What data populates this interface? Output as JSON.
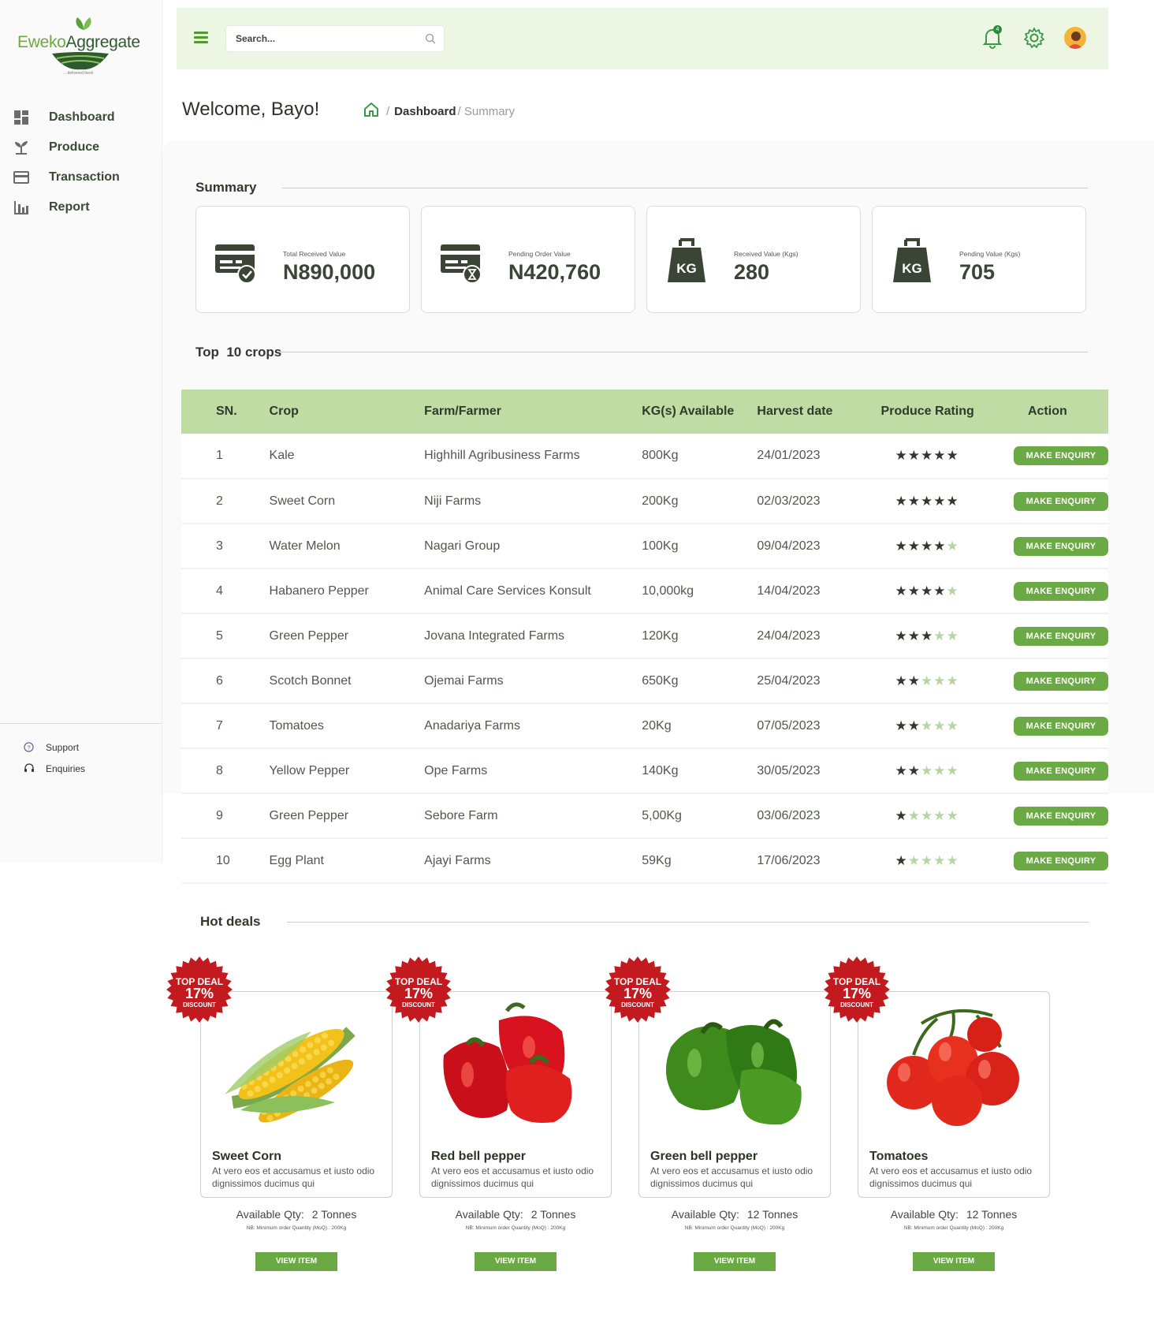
{
  "brand": {
    "name_part1": "Eweko",
    "name_part2": "Aggregate",
    "tagline": "... delivered fresh",
    "primary_color": "#6aa944",
    "topbar_color": "#edf5e3",
    "table_header_color": "#c0dca5"
  },
  "sidebar": {
    "items": [
      {
        "label": "Dashboard",
        "icon": "dashboard-grid-icon"
      },
      {
        "label": "Produce",
        "icon": "sprout-icon"
      },
      {
        "label": "Transaction",
        "icon": "card-icon"
      },
      {
        "label": "Report",
        "icon": "bar-chart-icon"
      }
    ],
    "bottom_items": [
      {
        "label": "Support",
        "icon": "help-circle-icon"
      },
      {
        "label": "Enquiries",
        "icon": "headset-icon"
      }
    ]
  },
  "topbar": {
    "search_placeholder": "Search...",
    "notification_count": "4"
  },
  "header": {
    "welcome": "Welcome, Bayo!",
    "breadcrumb_current": "Dashboard",
    "breadcrumb_sub": "/ Summary"
  },
  "summary": {
    "title": "Summary",
    "cards": [
      {
        "label": "Total Received Value",
        "value": "N890,000",
        "icon": "card-check-icon"
      },
      {
        "label": "Pending Order Value",
        "value": "N420,760",
        "icon": "card-hourglass-icon"
      },
      {
        "label": "Received Value (Kgs)",
        "value": "280",
        "icon": "kg-weight-icon"
      },
      {
        "label": "Pending Value (Kgs)",
        "value": "705",
        "icon": "kg-weight-icon"
      }
    ]
  },
  "crops": {
    "title": "Top  10 crops",
    "columns": [
      "SN.",
      "Crop",
      "Farm/Farmer",
      "KG(s) Available",
      "Harvest date",
      "Produce Rating",
      "Action"
    ],
    "action_label": "MAKE ENQUIRY",
    "rows": [
      {
        "sn": "1",
        "crop": "Kale",
        "farm": "Highhill Agribusiness Farms",
        "kg": "800Kg",
        "date": "24/01/2023",
        "rating": 5
      },
      {
        "sn": "2",
        "crop": "Sweet Corn",
        "farm": "Niji Farms",
        "kg": "200Kg",
        "date": "02/03/2023",
        "rating": 5
      },
      {
        "sn": "3",
        "crop": "Water Melon",
        "farm": "Nagari Group",
        "kg": "100Kg",
        "date": "09/04/2023",
        "rating": 4
      },
      {
        "sn": "4",
        "crop": "Habanero Pepper",
        "farm": "Animal Care Services Konsult",
        "kg": "10,000kg",
        "date": "14/04/2023",
        "rating": 4
      },
      {
        "sn": "5",
        "crop": "Green Pepper",
        "farm": "Jovana Integrated Farms",
        "kg": "120Kg",
        "date": "24/04/2023",
        "rating": 3
      },
      {
        "sn": "6",
        "crop": "Scotch Bonnet",
        "farm": "Ojemai Farms",
        "kg": "650Kg",
        "date": "25/04/2023",
        "rating": 2
      },
      {
        "sn": "7",
        "crop": "Tomatoes",
        "farm": "Anadariya Farms",
        "kg": "20Kg",
        "date": "07/05/2023",
        "rating": 2
      },
      {
        "sn": "8",
        "crop": "Yellow Pepper",
        "farm": "Ope Farms",
        "kg": "140Kg",
        "date": "30/05/2023",
        "rating": 2
      },
      {
        "sn": "9",
        "crop": "Green Pepper",
        "farm": "Sebore Farm",
        "kg": "5,00Kg",
        "date": "03/06/2023",
        "rating": 1
      },
      {
        "sn": "10",
        "crop": "Egg Plant",
        "farm": "Ajayi Farms",
        "kg": "59Kg",
        "date": "17/06/2023",
        "rating": 1
      }
    ]
  },
  "deals": {
    "title": "Hot deals",
    "badge_top": "TOP DEAL",
    "badge_pct": "17%",
    "badge_bottom": "DISCOUNT",
    "qty_label": "Available Qty:",
    "moq_note": "NB: Minimum order Quantity (MoQ) : 200Kg",
    "button_label": "VIEW ITEM",
    "items": [
      {
        "name": "Sweet Corn",
        "desc": "At vero eos et accusamus et iusto odio dignissimos ducimus qui",
        "qty": "2 Tonnes",
        "image": "corn-image"
      },
      {
        "name": "Red bell pepper",
        "desc": "At vero eos et accusamus et iusto odio dignissimos ducimus qui",
        "qty": "2 Tonnes",
        "image": "red-pepper-image"
      },
      {
        "name": "Green bell pepper",
        "desc": "At vero eos et accusamus et iusto odio dignissimos ducimus qui",
        "qty": "12 Tonnes",
        "image": "green-pepper-image"
      },
      {
        "name": "Tomatoes",
        "desc": "At vero eos et accusamus et iusto odio dignissimos ducimus qui",
        "qty": "12 Tonnes",
        "image": "tomatoes-image"
      }
    ]
  }
}
